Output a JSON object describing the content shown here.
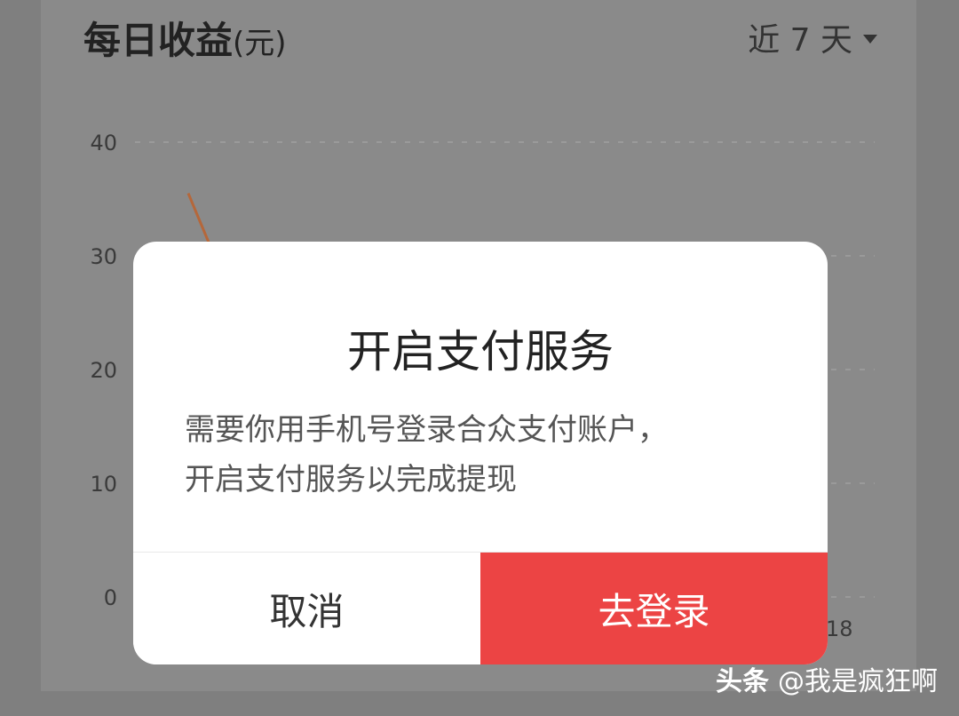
{
  "card": {
    "title": "每日收益",
    "title_unit": "(元)",
    "range_label": "近 7 天"
  },
  "chart_data": {
    "type": "line",
    "title": "每日收益(元)",
    "y_ticks": [
      "40",
      "30",
      "20",
      "10",
      "0"
    ],
    "ylim": [
      0,
      40
    ],
    "x_visible_tick": "18",
    "series": [
      {
        "values": [
          35.5,
          31
        ]
      }
    ],
    "grid": true,
    "line_color": "#b5673a"
  },
  "dialog": {
    "title": "开启支付服务",
    "message_line1": "需要你用手机号登录合众支付账户，",
    "message_line2": "开启支付服务以完成提现",
    "cancel_label": "取消",
    "login_label": "去登录"
  },
  "watermark": {
    "brand": "头条",
    "handle": "@我是疯狂啊"
  },
  "colors": {
    "overlay": "#7f7f7f",
    "primary_button": "#ec4444",
    "dialog_bg": "#ffffff"
  }
}
